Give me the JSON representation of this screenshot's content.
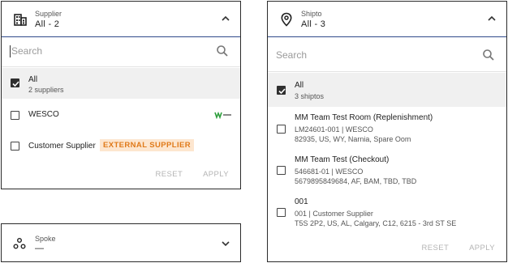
{
  "supplier": {
    "label": "Supplier",
    "value": "All -  2",
    "search_placeholder": "Search",
    "options": [
      {
        "title": "All",
        "subtitle": "2 suppliers",
        "checked": true
      },
      {
        "title": "WESCO",
        "logo_text": "wesco",
        "checked": false
      },
      {
        "title": "Customer Supplier",
        "badge": "EXTERNAL SUPPLIER",
        "checked": false
      }
    ],
    "reset_label": "RESET",
    "apply_label": "APPLY"
  },
  "spoke": {
    "label": "Spoke",
    "value": "—"
  },
  "shipto": {
    "label": "Shipto",
    "value": "All -  3",
    "search_placeholder": "Search",
    "options": [
      {
        "title": "All",
        "subtitle": "3 shiptos",
        "checked": true
      },
      {
        "title": "MM Team Test Room (Replenishment)",
        "line1": "LM24601-001 | WESCO",
        "line2": "82935, US, WY, Narnia, Spare Oom",
        "checked": false
      },
      {
        "title": "MM Team Test (Checkout)",
        "line1": "546681-01 | WESCO",
        "line2": "5679895849684, AF, BAM, TBD, TBD",
        "checked": false
      },
      {
        "title": "001",
        "line1": "001 | Customer Supplier",
        "line2": "T5S 2P2, US, AL, Calgary, C12, 6215 - 3rd ST SE",
        "checked": false
      }
    ],
    "reset_label": "RESET",
    "apply_label": "APPLY"
  },
  "colors": {
    "badge_text": "#e07a1a",
    "badge_bg": "#fde6cf",
    "header_underline": "#2f4a8a",
    "wesco_logo": "#2e9e3c"
  },
  "icons": [
    "building-icon",
    "location-pin-icon",
    "spoke-icon",
    "search-icon",
    "chevron-up-icon",
    "chevron-down-icon",
    "checkbox-checked-icon",
    "wesco-logo"
  ]
}
